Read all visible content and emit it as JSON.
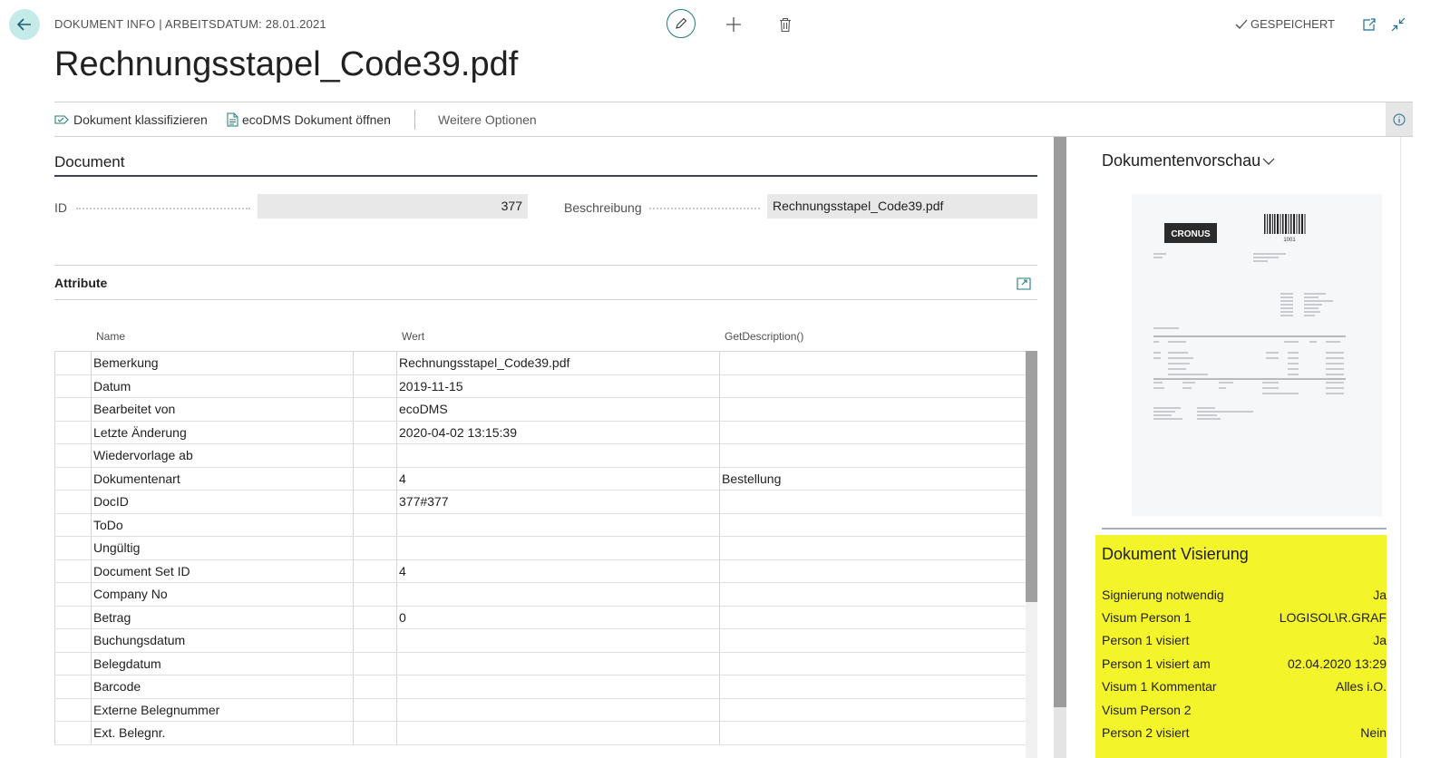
{
  "header": {
    "caption": "DOKUMENT INFO | ARBEITSDATUM: 28.01.2021",
    "title": "Rechnungsstapel_Code39.pdf",
    "saved_label": "GESPEICHERT"
  },
  "actions": {
    "classify": "Dokument klassifizieren",
    "open_ecodms": "ecoDMS Dokument öffnen",
    "more": "Weitere Optionen"
  },
  "document": {
    "section_title": "Document",
    "id_label": "ID",
    "id_value": "377",
    "description_label": "Beschreibung",
    "description_value": "Rechnungsstapel_Code39.pdf"
  },
  "attributes": {
    "title": "Attribute",
    "columns": [
      "Name",
      "Wert",
      "GetDescription()"
    ],
    "rows": [
      {
        "name": "Bemerkung",
        "value": "Rechnungsstapel_Code39.pdf",
        "desc": ""
      },
      {
        "name": "Datum",
        "value": "2019-11-15",
        "desc": ""
      },
      {
        "name": "Bearbeitet von",
        "value": "ecoDMS",
        "desc": ""
      },
      {
        "name": "Letzte Änderung",
        "value": "2020-04-02 13:15:39",
        "desc": ""
      },
      {
        "name": "Wiedervorlage ab",
        "value": "",
        "desc": ""
      },
      {
        "name": "Dokumentenart",
        "value": "4",
        "desc": "Bestellung"
      },
      {
        "name": "DocID",
        "value": "377#377",
        "desc": ""
      },
      {
        "name": "ToDo",
        "value": "",
        "desc": ""
      },
      {
        "name": "Ungültig",
        "value": "",
        "desc": ""
      },
      {
        "name": "Document Set ID",
        "value": "4",
        "desc": ""
      },
      {
        "name": "Company No",
        "value": "",
        "desc": ""
      },
      {
        "name": "Betrag",
        "value": "0",
        "desc": ""
      },
      {
        "name": "Buchungsdatum",
        "value": "",
        "desc": ""
      },
      {
        "name": "Belegdatum",
        "value": "",
        "desc": ""
      },
      {
        "name": "Barcode",
        "value": "",
        "desc": ""
      },
      {
        "name": "Externe Belegnummer",
        "value": "",
        "desc": ""
      },
      {
        "name": "Ext. Belegnr.",
        "value": "",
        "desc": ""
      }
    ]
  },
  "preview": {
    "title": "Dokumentenvorschau",
    "doc_logo": "CRONUS",
    "doc_barcode_number": "1001"
  },
  "visum": {
    "title": "Dokument Visierung",
    "rows": [
      {
        "label": "Signierung notwendig",
        "value": "Ja"
      },
      {
        "label": "Visum Person 1",
        "value": "LOGISOL\\R.GRAF"
      },
      {
        "label": "Person 1 visiert",
        "value": "Ja"
      },
      {
        "label": "Person 1 visiert am",
        "value": "02.04.2020 13:29"
      },
      {
        "label": "Visum 1 Kommentar",
        "value": "Alles i.O."
      },
      {
        "label": "Visum Person 2",
        "value": ""
      },
      {
        "label": "Person 2 visiert",
        "value": "Nein"
      }
    ]
  },
  "colors": {
    "accent": "#1f7b7b",
    "back_button_bg": "#c4ebe8",
    "visum_highlight": "#f4f42a"
  }
}
